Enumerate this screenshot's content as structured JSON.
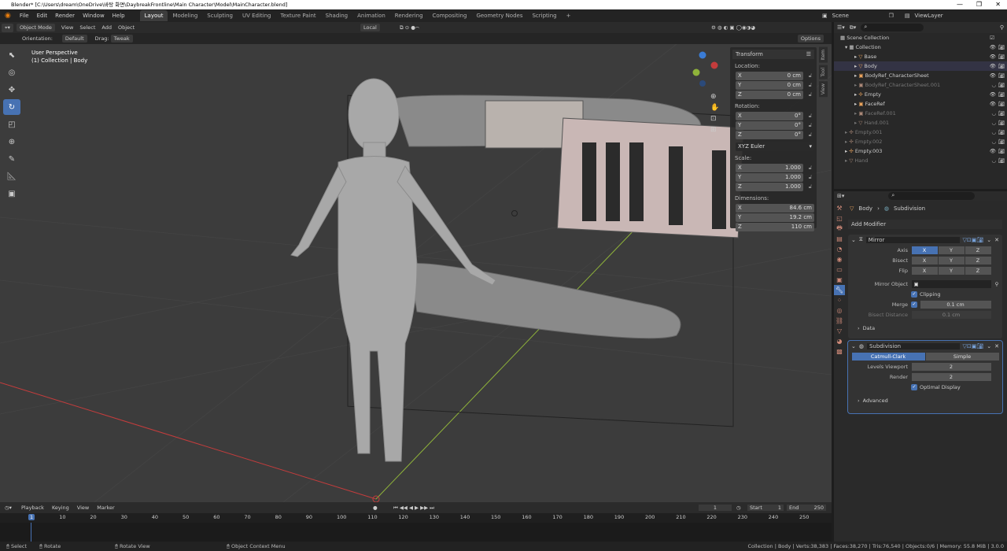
{
  "title_bar": {
    "text": "Blender* [C:\\Users\\dream\\OneDrive\\바탕 화면\\DaybreakFrontline\\Main Character\\Model\\MainCharacter.blend]",
    "controls": [
      "—",
      "❐",
      "✕"
    ]
  },
  "top_menu": [
    "File",
    "Edit",
    "Render",
    "Window",
    "Help"
  ],
  "workspace_tabs": [
    "Layout",
    "Modeling",
    "Sculpting",
    "UV Editing",
    "Texture Paint",
    "Shading",
    "Animation",
    "Rendering",
    "Compositing",
    "Geometry Nodes",
    "Scripting"
  ],
  "active_workspace": "Layout",
  "scene": {
    "name": "Scene",
    "viewlayer": "ViewLayer"
  },
  "viewport_header": {
    "mode": "Object Mode",
    "menus": [
      "View",
      "Select",
      "Add",
      "Object"
    ],
    "pivot": "Local",
    "options": "Options"
  },
  "tool_settings": {
    "orientation_label": "Orientation:",
    "orientation": "Default",
    "drag_label": "Drag:",
    "drag": "Tweak"
  },
  "viewport": {
    "perspective": "User Perspective",
    "collection": "(1) Collection | Body"
  },
  "transform_panel": {
    "title": "Transform",
    "location_label": "Location:",
    "location": [
      {
        "axis": "X",
        "value": "0 cm"
      },
      {
        "axis": "Y",
        "value": "0 cm"
      },
      {
        "axis": "Z",
        "value": "0 cm"
      }
    ],
    "rotation_label": "Rotation:",
    "rotation": [
      {
        "axis": "X",
        "value": "0°"
      },
      {
        "axis": "Y",
        "value": "0°"
      },
      {
        "axis": "Z",
        "value": "0°"
      }
    ],
    "rotation_mode": "XYZ Euler",
    "scale_label": "Scale:",
    "scale": [
      {
        "axis": "X",
        "value": "1.000"
      },
      {
        "axis": "Y",
        "value": "1.000"
      },
      {
        "axis": "Z",
        "value": "1.000"
      }
    ],
    "dimensions_label": "Dimensions:",
    "dimensions": [
      {
        "axis": "X",
        "value": "84.6 cm"
      },
      {
        "axis": "Y",
        "value": "19.2 cm"
      },
      {
        "axis": "Z",
        "value": "110 cm"
      }
    ]
  },
  "side_tabs": [
    "Item",
    "Tool",
    "View"
  ],
  "outliner": {
    "root": "Scene Collection",
    "collection": "Collection",
    "items": [
      {
        "name": "Base",
        "dim": false
      },
      {
        "name": "Body",
        "dim": false
      },
      {
        "name": "BodyRef_CharacterSheet",
        "dim": false
      },
      {
        "name": "BodyRef_CharacterSheet.001",
        "dim": true
      },
      {
        "name": "Empty",
        "dim": false
      },
      {
        "name": "FaceRef",
        "dim": false
      },
      {
        "name": "FaceRef.001",
        "dim": true
      },
      {
        "name": "Hand.001",
        "dim": true
      }
    ],
    "root_items": [
      {
        "name": "Empty.001",
        "dim": true
      },
      {
        "name": "Empty.002",
        "dim": true
      },
      {
        "name": "Empty.003",
        "dim": false
      },
      {
        "name": "Hand",
        "dim": true
      }
    ]
  },
  "properties": {
    "object": "Body",
    "modifier_ctx": "Subdivision",
    "add_modifier": "Add Modifier",
    "mirror": {
      "name": "Mirror",
      "axis_label": "Axis",
      "bisect_label": "Bisect",
      "flip_label": "Flip",
      "xyz": [
        "X",
        "Y",
        "Z"
      ],
      "mirror_object_label": "Mirror Object",
      "clipping": "Clipping",
      "merge_label": "Merge",
      "merge_value": "0.1 cm",
      "bisect_distance_label": "Bisect Distance",
      "bisect_distance": "0.1 cm",
      "data": "Data"
    },
    "subdivision": {
      "name": "Subdivision",
      "catmull": "Catmull-Clark",
      "simple": "Simple",
      "levels_label": "Levels Viewport",
      "levels": "2",
      "render_label": "Render",
      "render": "2",
      "optimal": "Optimal Display",
      "advanced": "Advanced"
    }
  },
  "timeline": {
    "menus": [
      "Playback",
      "Keying",
      "View",
      "Marker"
    ],
    "current_frame": "1",
    "start_label": "Start",
    "start": "1",
    "end_label": "End",
    "end": "250",
    "ticks": [
      "1",
      "10",
      "20",
      "30",
      "40",
      "50",
      "60",
      "70",
      "80",
      "90",
      "100",
      "110",
      "120",
      "130",
      "140",
      "150",
      "160",
      "170",
      "180",
      "190",
      "200",
      "210",
      "220",
      "230",
      "240",
      "250"
    ]
  },
  "status_bar": {
    "select": "Select",
    "rotate": "Rotate",
    "rotate_view": "Rotate View",
    "context": "Object Context Menu",
    "stats": "Collection | Body | Verts:38,383 | Faces:38,270 | Tris:76,540 | Objects:0/6 | Memory: 55.8 MiB | 3.0.0"
  },
  "colors": {
    "accent": "#4772b3",
    "viewport_bg": "#3c3c3c",
    "x_axis": "#c43c3c",
    "y_axis": "#8fb33a"
  }
}
